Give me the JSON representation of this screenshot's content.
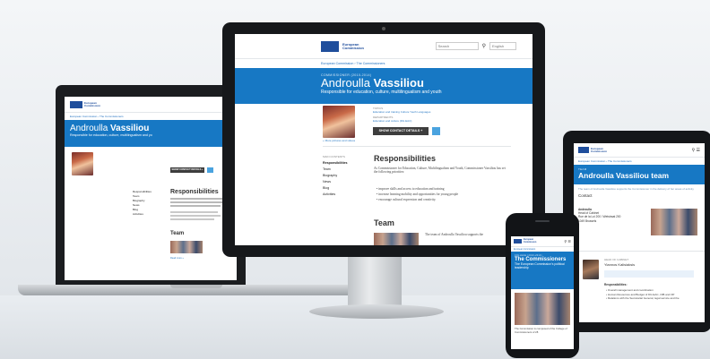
{
  "brand": {
    "logo_text": "European Commission",
    "breadcrumb": [
      "European Commission",
      "The Commissioners"
    ]
  },
  "search": {
    "placeholder": "Search",
    "language": "English"
  },
  "desktop": {
    "label": "COMMISSIONER (2010-2014)",
    "first_name": "Androulla",
    "last_name": "Vassiliou",
    "tagline": "Responsible for education, culture, multilingualism and youth",
    "topics_label": "TOPICS",
    "topics": "Education and training   Culture   Youth   Languages",
    "departments_label": "DEPARTMENTS",
    "departments": "Education and culture (DG EAC)",
    "photo_link": "+ More pictures and videos",
    "contact_button": "SHOW CONTACT DETAILS  +",
    "side_heading": "MAIN CONTENTS",
    "side_items": [
      "Responsibilities",
      "Team",
      "Biography",
      "News",
      "Blog",
      "Activities"
    ],
    "section_title": "Responsibilities",
    "intro": "As Commissioner for Education, Culture, Multilingualism and Youth, Commissioner Vassiliou has set the following priorities:",
    "bullets": [
      "improve skills and access to education and training",
      "increase learning mobility and opportunities for young people",
      "encourage cultural expression and creativity."
    ],
    "team_title": "Team",
    "team_text": "The team of Androulla Vassiliou supports the"
  },
  "laptop": {
    "first_name": "Androulla",
    "last_name": "Vassiliou",
    "tagline": "Responsible for education, culture, multilingualism and yo",
    "contact_button": "SHOW CONTACT DETAILS +",
    "side_items": [
      "Responsibilities",
      "Team",
      "Biography",
      "News",
      "Blog",
      "Activities"
    ],
    "section_title": "Responsibilities",
    "team_title": "Team",
    "team_link": "Read more »"
  },
  "tablet": {
    "label": "Team",
    "title": "Androulla Vassiliou team",
    "intro": "The team of Androulla Vassiliou supports the Commissioner in the delivery of her areas of activity",
    "contact_label": "Contact",
    "person_name": "Androulla",
    "person_role": "Head of Cabinet",
    "address": "Rue de la Loi 200 / Wetstraat 200 1049 Brussels",
    "member_title": "HEAD OF CABINET",
    "member_name": "Yiannos  Kalisiaksis",
    "resp_label": "Responsibilities:",
    "resp_items": [
      "Overall management and coordination",
      "Human Resources and Budget of DG EAC, OIB and OP",
      "Relations with the Secretariat General, legal service and the"
    ]
  },
  "phone": {
    "label": "COLLEGE (2010-2014)",
    "title": "The Commissioners",
    "subtitle": "The European Commission's political leadership",
    "body": "The Commission is composed of the College of Commissioners of 28"
  },
  "colors": {
    "accent": "#1778c4",
    "link": "#1f6fbf",
    "frame": "#1b1d20"
  }
}
